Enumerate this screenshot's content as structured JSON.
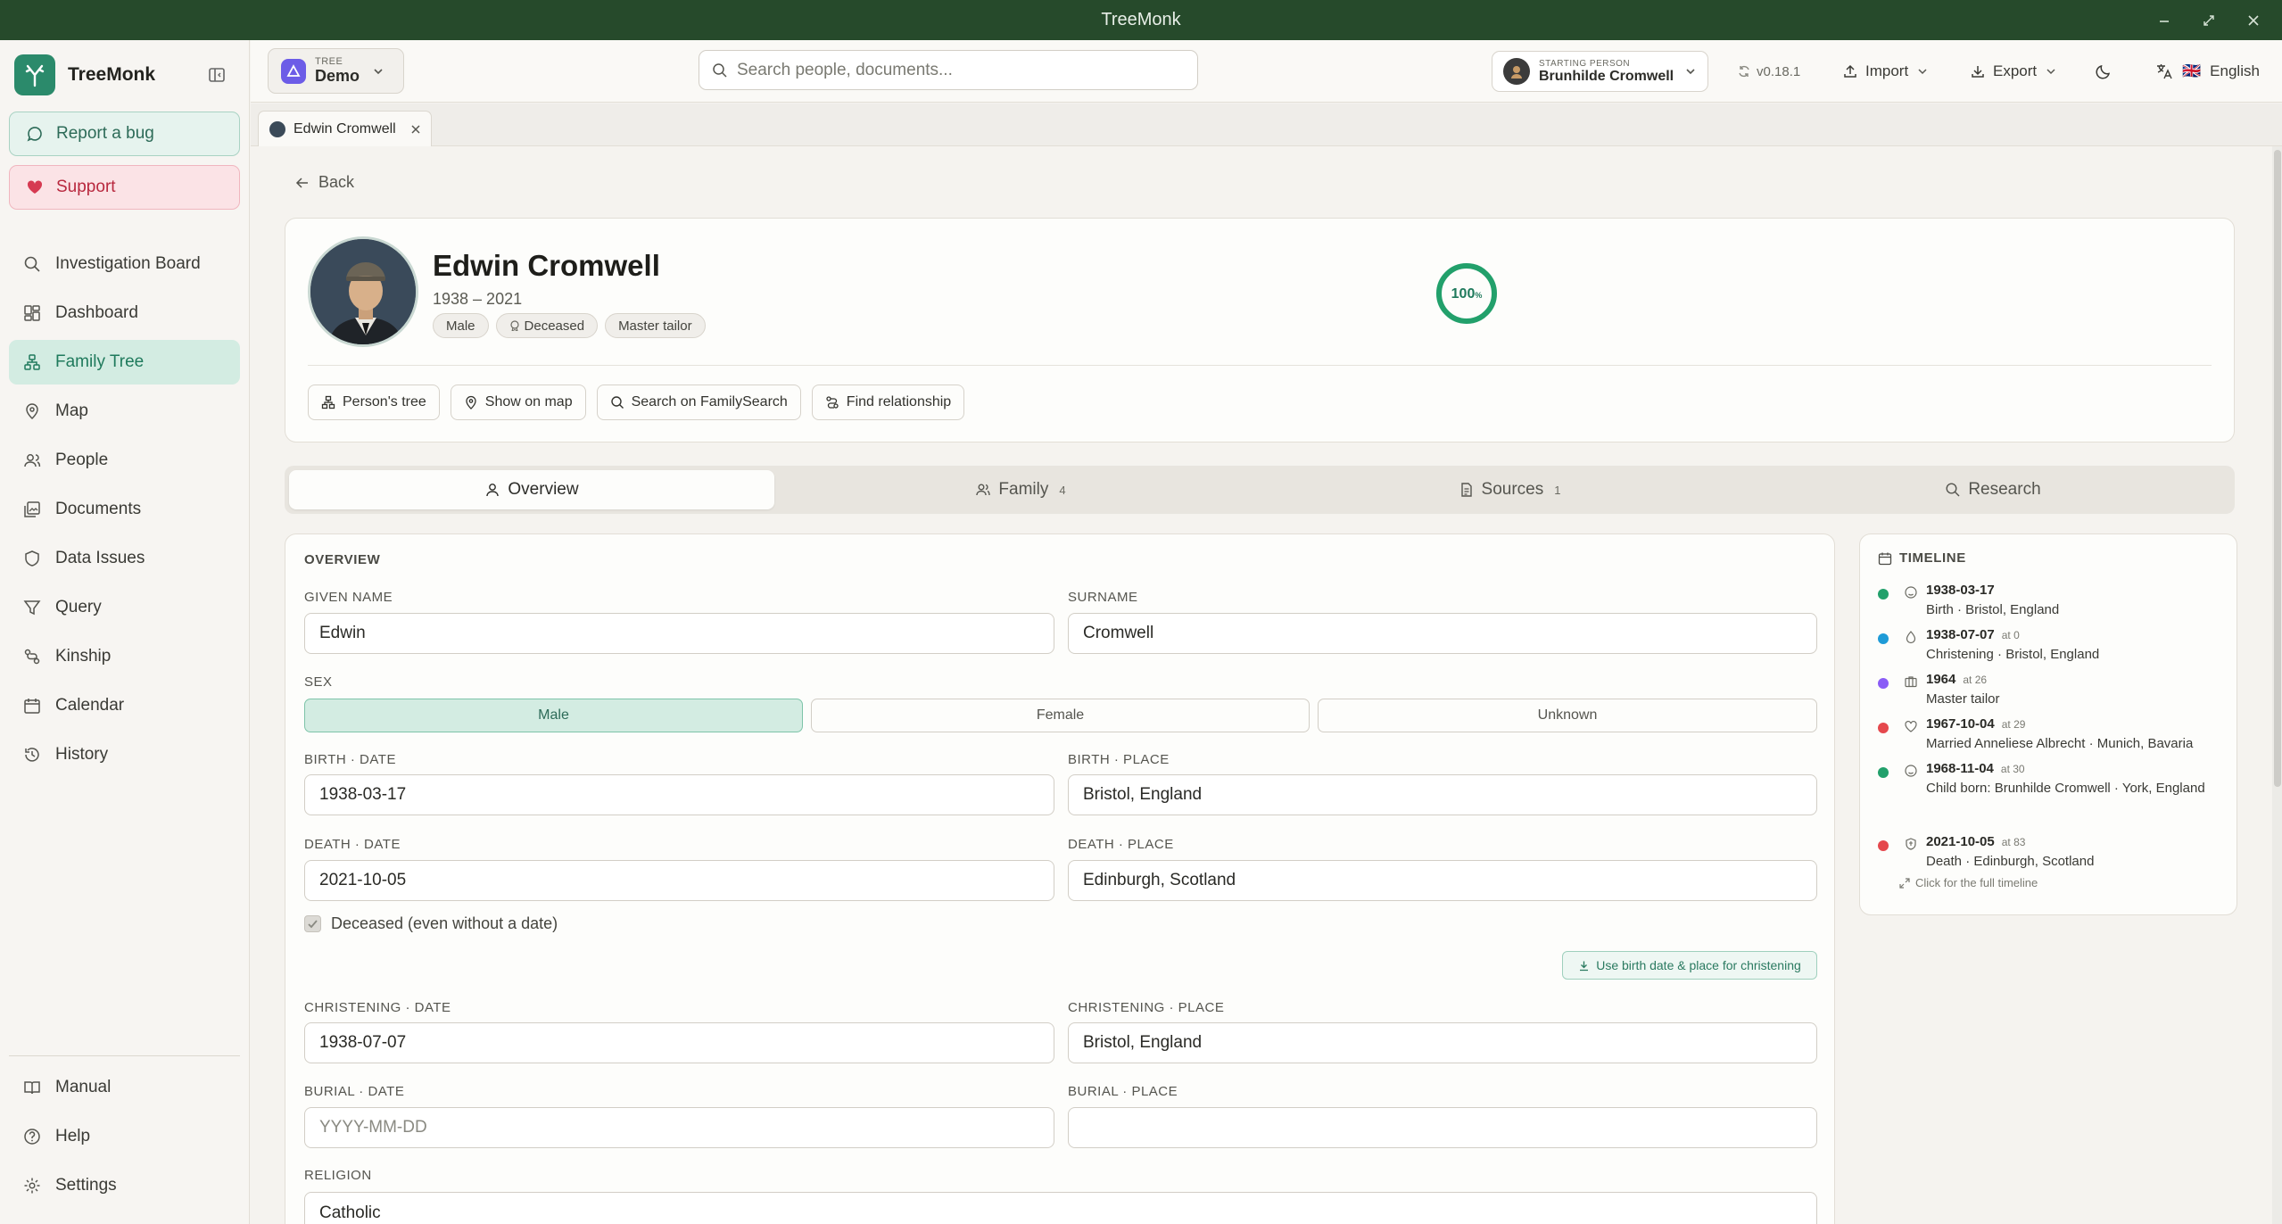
{
  "window": {
    "title": "TreeMonk"
  },
  "sidebar": {
    "brand": "TreeMonk",
    "report_bug": "Report a bug",
    "support": "Support",
    "items": [
      {
        "label": "Investigation Board",
        "icon": "search-icon"
      },
      {
        "label": "Dashboard",
        "icon": "dashboard-icon"
      },
      {
        "label": "Family Tree",
        "icon": "tree-icon",
        "active": true
      },
      {
        "label": "Map",
        "icon": "map-pin-icon"
      },
      {
        "label": "People",
        "icon": "people-icon"
      },
      {
        "label": "Documents",
        "icon": "documents-icon"
      },
      {
        "label": "Data Issues",
        "icon": "shield-icon"
      },
      {
        "label": "Query",
        "icon": "filter-icon"
      },
      {
        "label": "Kinship",
        "icon": "kinship-icon"
      },
      {
        "label": "Calendar",
        "icon": "calendar-icon"
      },
      {
        "label": "History",
        "icon": "history-icon"
      }
    ],
    "bottom": [
      {
        "label": "Manual",
        "icon": "book-icon"
      },
      {
        "label": "Help",
        "icon": "help-icon"
      },
      {
        "label": "Settings",
        "icon": "gear-icon"
      }
    ]
  },
  "topbar": {
    "tree_caption": "TREE",
    "tree_name": "Demo",
    "search_placeholder": "Search people, documents...",
    "starting_caption": "STARTING PERSON",
    "starting_name": "Brunhilde Cromwell",
    "version": "v0.18.1",
    "import": "Import",
    "export": "Export",
    "language": "English",
    "language_flag": "🇬🇧"
  },
  "open_tab": {
    "label": "Edwin Cromwell"
  },
  "back": "Back",
  "person": {
    "name": "Edwin Cromwell",
    "dates": "1938 – 2021",
    "tags": [
      "Male",
      "Deceased",
      "Master tailor"
    ],
    "completeness": 100,
    "completeness_label": "100",
    "completeness_unit": "%",
    "actions": [
      "Person's tree",
      "Show on map",
      "Search on FamilySearch",
      "Find relationship"
    ]
  },
  "tabs": [
    {
      "label": "Overview",
      "count": ""
    },
    {
      "label": "Family",
      "count": "4"
    },
    {
      "label": "Sources",
      "count": "1"
    },
    {
      "label": "Research",
      "count": ""
    }
  ],
  "overview": {
    "section": "OVERVIEW",
    "given_label": "GIVEN NAME",
    "given": "Edwin",
    "surname_label": "SURNAME",
    "surname": "Cromwell",
    "sex_label": "SEX",
    "sex_options": [
      "Male",
      "Female",
      "Unknown"
    ],
    "sex_selected": "Male",
    "birth_date_label": "BIRTH · DATE",
    "birth_date": "1938-03-17",
    "birth_place_label": "BIRTH · PLACE",
    "birth_place": "Bristol, England",
    "death_date_label": "DEATH · DATE",
    "death_date": "2021-10-05",
    "death_place_label": "DEATH · PLACE",
    "death_place": "Edinburgh, Scotland",
    "deceased_label": "Deceased (even without a date)",
    "deceased_checked": true,
    "use_birth_btn": "Use birth date & place for christening",
    "christ_date_label": "CHRISTENING · DATE",
    "christ_date": "1938-07-07",
    "christ_place_label": "CHRISTENING · PLACE",
    "christ_place": "Bristol, England",
    "burial_date_label": "BURIAL · DATE",
    "burial_date_placeholder": "YYYY-MM-DD",
    "burial_place_label": "BURIAL · PLACE",
    "burial_place": "",
    "religion_label": "RELIGION",
    "religion": "Catholic"
  },
  "timeline": {
    "title": "TIMELINE",
    "events": [
      {
        "date": "1938-03-17",
        "age": "",
        "text": "Birth · Bristol, England",
        "color": "#22a06b",
        "icon": "birth-icon"
      },
      {
        "date": "1938-07-07",
        "age": "at 0",
        "text": "Christening · Bristol, England",
        "color": "#1e9bd7",
        "icon": "water-drop-icon"
      },
      {
        "date": "1964",
        "age": "at 26",
        "text": "Master tailor",
        "color": "#8a5cf6",
        "icon": "briefcase-icon"
      },
      {
        "date": "1967-10-04",
        "age": "at 29",
        "text": "Married Anneliese Albrecht · Munich, Bavaria",
        "color": "#e5484d",
        "icon": "heart-icon"
      },
      {
        "date": "1968-11-04",
        "age": "at 30",
        "text": "Child born: Brunhilde Cromwell · York, England",
        "color": "#22a06b",
        "icon": "birth-icon"
      },
      {
        "date": "2021-10-05",
        "age": "at 83",
        "text": "Death · Edinburgh, Scotland",
        "color": "#e5484d",
        "icon": "death-icon"
      }
    ],
    "footer": "Click for the full timeline"
  },
  "colors": {
    "accent": "#2b8a6b",
    "titlebar": "#264a2b",
    "support": "#b8283e"
  }
}
